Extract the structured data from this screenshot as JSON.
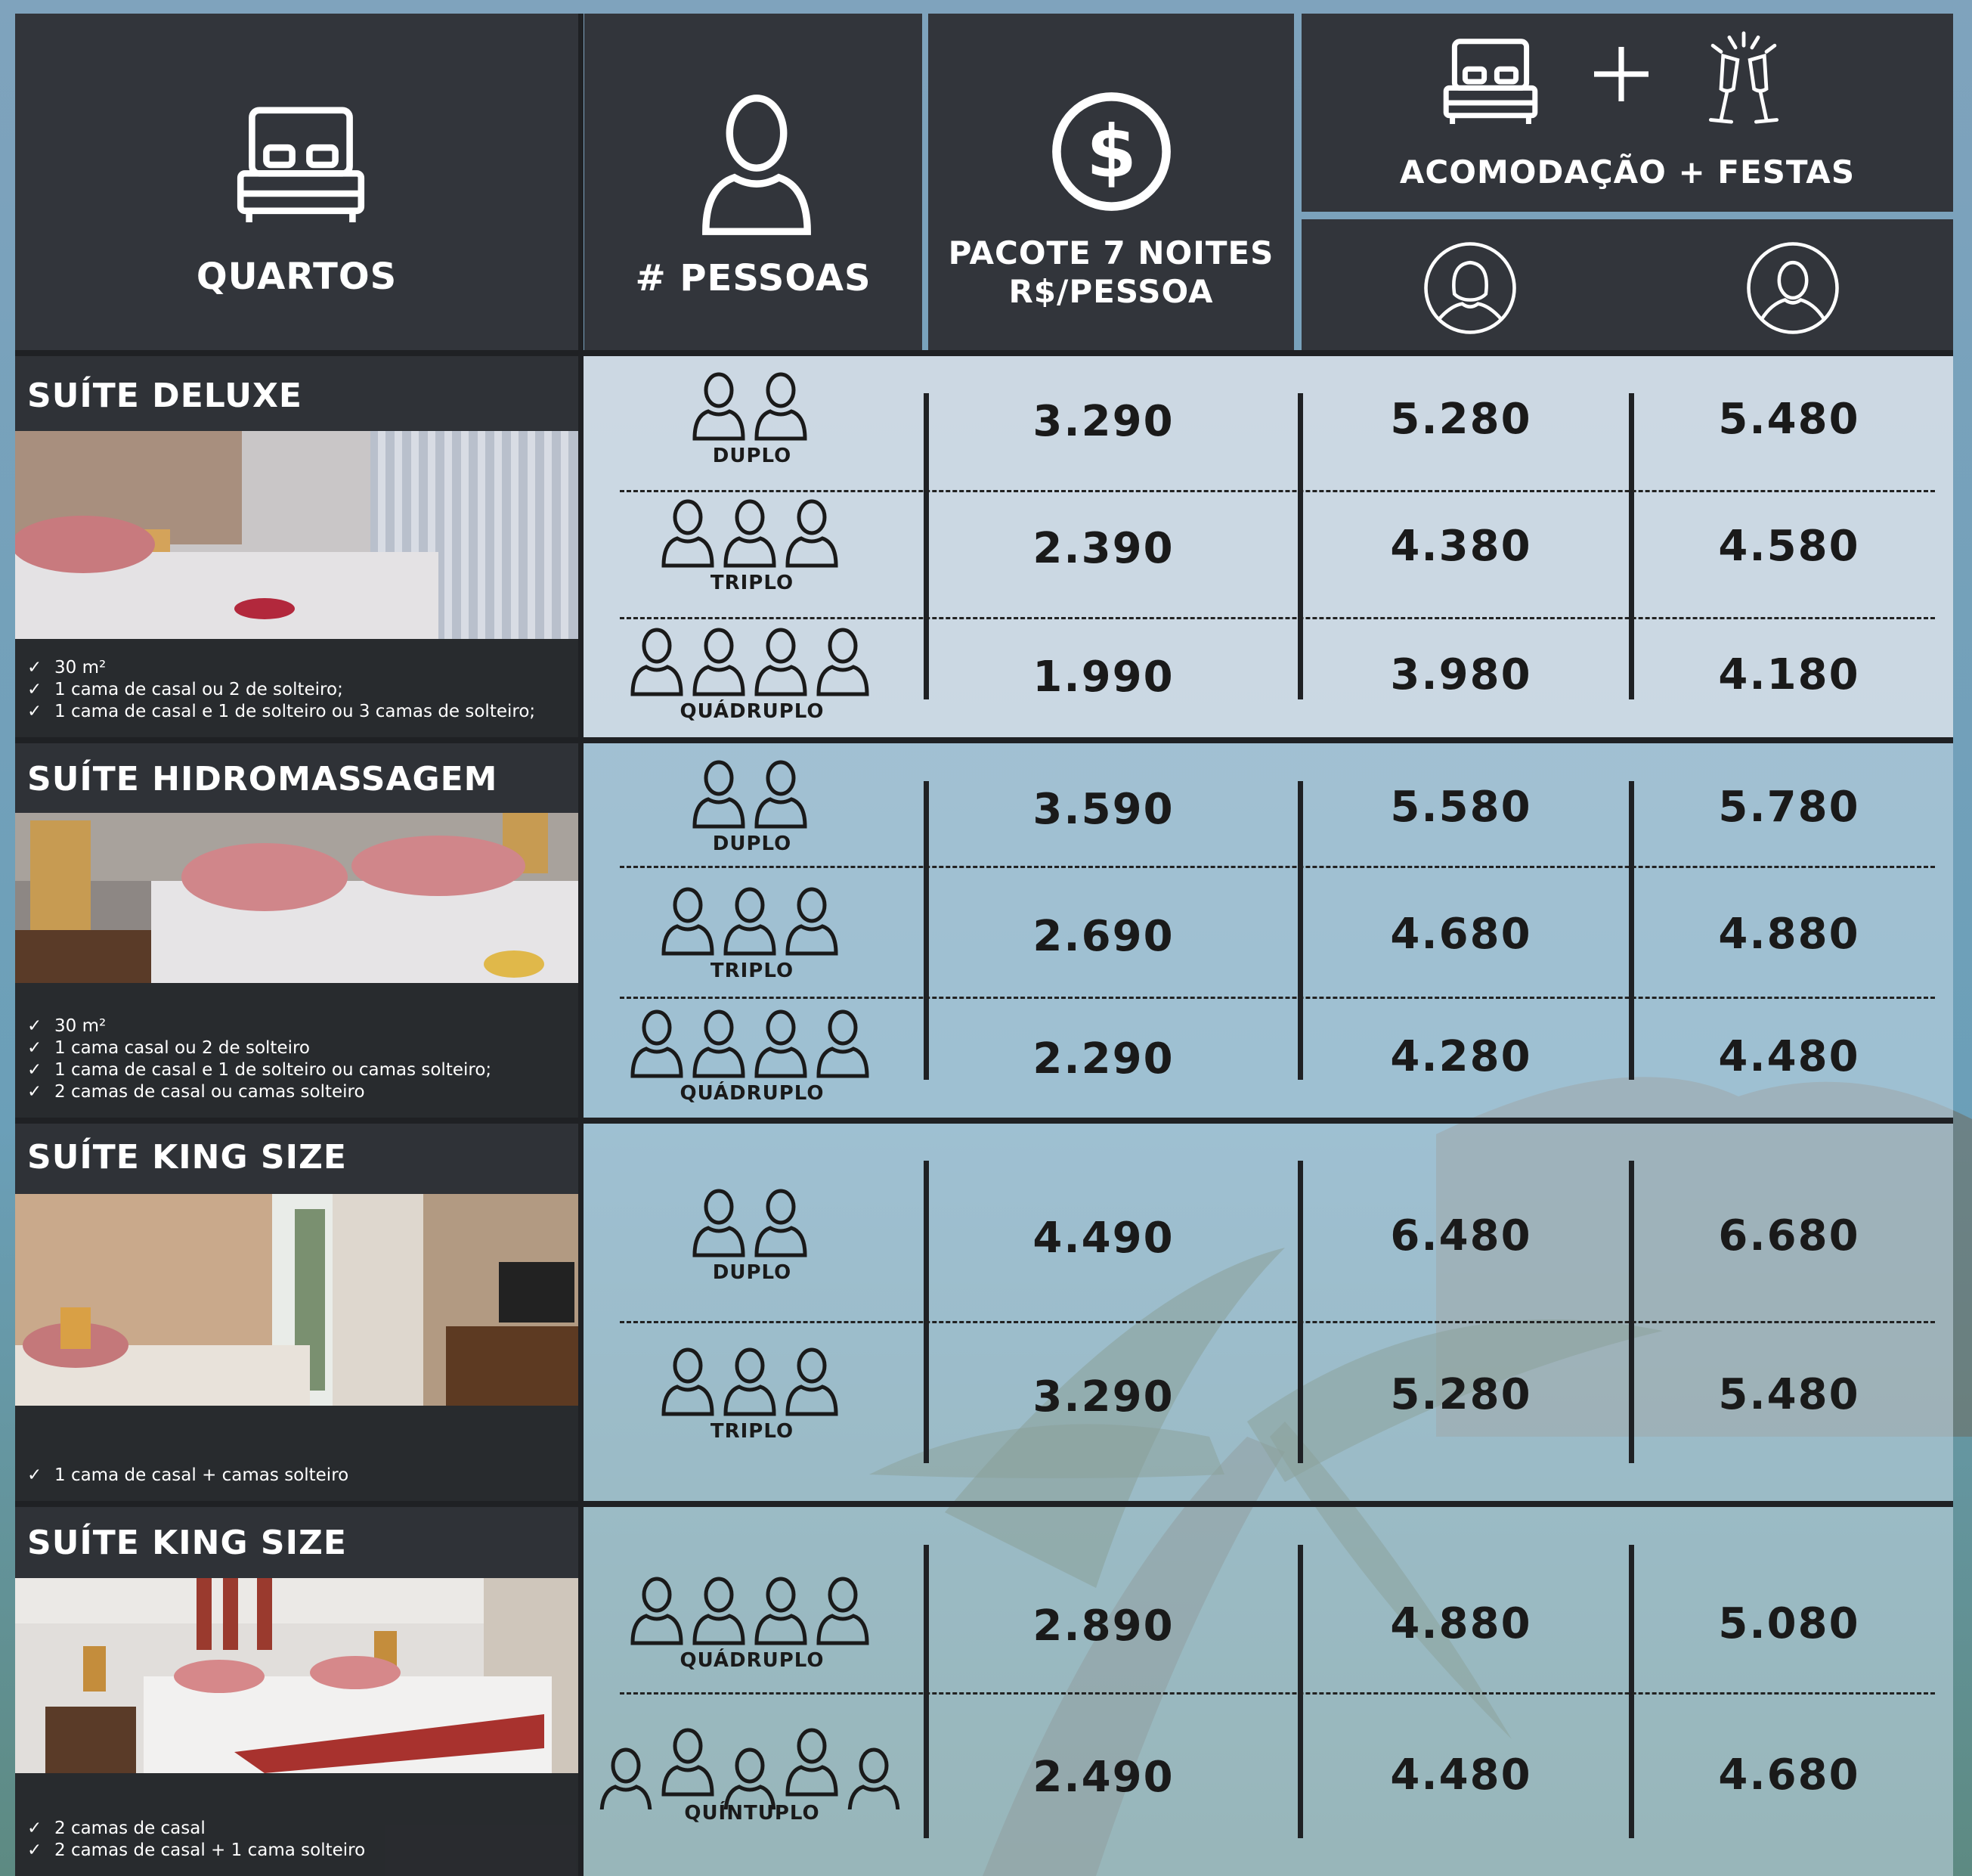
{
  "header": {
    "rooms_label": "QUARTOS",
    "people_label": "# PESSOAS",
    "package_label_line1": "PACOTE 7 NOITES",
    "package_label_line2": "R$/PESSOA",
    "combo_label": "ACOMODAÇÃO + FESTAS",
    "icons": [
      "bed-icon",
      "person-icon",
      "dollar-icon",
      "bed-icon",
      "plus-icon",
      "champagne-toast-icon",
      "female-avatar-icon",
      "male-avatar-icon"
    ]
  },
  "rooms": [
    {
      "title": "SUÍTE DELUXE",
      "features": [
        "30 m²",
        "1 cama de casal ou 2 de solteiro;",
        "1 cama de casal e 1 de solteiro ou 3 camas de solteiro;"
      ],
      "rows": [
        {
          "occupancy": "DUPLO",
          "people": 2,
          "package": "3.290",
          "female": "5.280",
          "male": "5.480"
        },
        {
          "occupancy": "TRIPLO",
          "people": 3,
          "package": "2.390",
          "female": "4.380",
          "male": "4.580"
        },
        {
          "occupancy": "QUÁDRUPLO",
          "people": 4,
          "package": "1.990",
          "female": "3.980",
          "male": "4.180"
        }
      ]
    },
    {
      "title": "SUÍTE HIDROMASSAGEM",
      "features": [
        "30 m²",
        "1 cama casal ou 2 de solteiro",
        "1 cama de casal e 1 de solteiro ou camas solteiro;",
        "2 camas de casal ou camas solteiro"
      ],
      "rows": [
        {
          "occupancy": "DUPLO",
          "people": 2,
          "package": "3.590",
          "female": "5.580",
          "male": "5.780"
        },
        {
          "occupancy": "TRIPLO",
          "people": 3,
          "package": "2.690",
          "female": "4.680",
          "male": "4.880"
        },
        {
          "occupancy": "QUÁDRUPLO",
          "people": 4,
          "package": "2.290",
          "female": "4.280",
          "male": "4.480"
        }
      ]
    },
    {
      "title": "SUÍTE KING SIZE",
      "features": [
        "1 cama de casal + camas solteiro"
      ],
      "rows": [
        {
          "occupancy": "DUPLO",
          "people": 2,
          "package": "4.490",
          "female": "6.480",
          "male": "6.680"
        },
        {
          "occupancy": "TRIPLO",
          "people": 3,
          "package": "3.290",
          "female": "5.280",
          "male": "5.480"
        }
      ]
    },
    {
      "title": "SUÍTE KING SIZE",
      "features": [
        "2 camas de casal",
        "2 camas de casal + 1 cama solteiro"
      ],
      "rows": [
        {
          "occupancy": "QUÁDRUPLO",
          "people": 4,
          "package": "2.890",
          "female": "4.880",
          "male": "5.080"
        },
        {
          "occupancy": "QUÍNTUPLO",
          "people": 5,
          "package": "2.490",
          "female": "4.480",
          "male": "4.680"
        }
      ]
    }
  ],
  "colors": {
    "header_bg": "#32353b",
    "text_dark": "#1a1a1a",
    "divider": "#1f2124"
  }
}
